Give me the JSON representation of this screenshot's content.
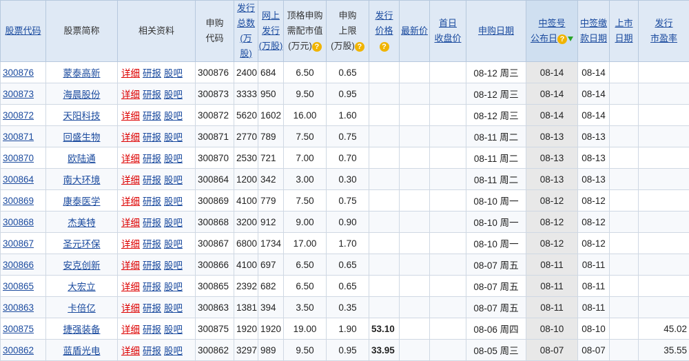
{
  "header": {
    "code": "股票代码",
    "name": "股票简称",
    "links": "相关资料",
    "subcode_l1": "申购",
    "subcode_l2": "代码",
    "total_l1": "发行",
    "total_l2": "总数",
    "total_l3": "(万股)",
    "online_l1": "网上",
    "online_l2": "发行",
    "online_l3": "(万股)",
    "cap_l1": "顶格申购",
    "cap_l2": "需配市值",
    "cap_l3": "(万元)",
    "limit_l1": "申购",
    "limit_l2": "上限",
    "limit_l3": "(万股)",
    "price_l1": "发行",
    "price_l2": "价格",
    "latest": "最新价",
    "firstday_l1": "首日",
    "firstday_l2": "收盘价",
    "subdate": "申购日期",
    "lot_l1": "中签号",
    "lot_l2": "公布日",
    "paydate_l1": "中签缴",
    "paydate_l2": "款日期",
    "listdate_l1": "上市",
    "listdate_l2": "日期",
    "pe_l1": "发行",
    "pe_l2": "市盈率",
    "help_icon": "?"
  },
  "link_labels": {
    "detail": "详细",
    "research": "研报",
    "forum": "股吧"
  },
  "rows": [
    {
      "code": "300876",
      "name": "蒙泰高新",
      "subcode": "300876",
      "total": "2400",
      "online": "684",
      "cap": "6.50",
      "limit": "0.65",
      "price": "",
      "latest": "",
      "first": "",
      "subdate": "08-12 周三",
      "lotdate": "08-14",
      "paydate": "08-14",
      "listdate": "",
      "pe": ""
    },
    {
      "code": "300873",
      "name": "海晨股份",
      "subcode": "300873",
      "total": "3333",
      "online": "950",
      "cap": "9.50",
      "limit": "0.95",
      "price": "",
      "latest": "",
      "first": "",
      "subdate": "08-12 周三",
      "lotdate": "08-14",
      "paydate": "08-14",
      "listdate": "",
      "pe": ""
    },
    {
      "code": "300872",
      "name": "天阳科技",
      "subcode": "300872",
      "total": "5620",
      "online": "1602",
      "cap": "16.00",
      "limit": "1.60",
      "price": "",
      "latest": "",
      "first": "",
      "subdate": "08-12 周三",
      "lotdate": "08-14",
      "paydate": "08-14",
      "listdate": "",
      "pe": ""
    },
    {
      "code": "300871",
      "name": "回盛生物",
      "subcode": "300871",
      "total": "2770",
      "online": "789",
      "cap": "7.50",
      "limit": "0.75",
      "price": "",
      "latest": "",
      "first": "",
      "subdate": "08-11 周二",
      "lotdate": "08-13",
      "paydate": "08-13",
      "listdate": "",
      "pe": ""
    },
    {
      "code": "300870",
      "name": "欧陆通",
      "subcode": "300870",
      "total": "2530",
      "online": "721",
      "cap": "7.00",
      "limit": "0.70",
      "price": "",
      "latest": "",
      "first": "",
      "subdate": "08-11 周二",
      "lotdate": "08-13",
      "paydate": "08-13",
      "listdate": "",
      "pe": ""
    },
    {
      "code": "300864",
      "name": "南大环境",
      "subcode": "300864",
      "total": "1200",
      "online": "342",
      "cap": "3.00",
      "limit": "0.30",
      "price": "",
      "latest": "",
      "first": "",
      "subdate": "08-11 周二",
      "lotdate": "08-13",
      "paydate": "08-13",
      "listdate": "",
      "pe": ""
    },
    {
      "code": "300869",
      "name": "康泰医学",
      "subcode": "300869",
      "total": "4100",
      "online": "779",
      "cap": "7.50",
      "limit": "0.75",
      "price": "",
      "latest": "",
      "first": "",
      "subdate": "08-10 周一",
      "lotdate": "08-12",
      "paydate": "08-12",
      "listdate": "",
      "pe": ""
    },
    {
      "code": "300868",
      "name": "杰美特",
      "subcode": "300868",
      "total": "3200",
      "online": "912",
      "cap": "9.00",
      "limit": "0.90",
      "price": "",
      "latest": "",
      "first": "",
      "subdate": "08-10 周一",
      "lotdate": "08-12",
      "paydate": "08-12",
      "listdate": "",
      "pe": ""
    },
    {
      "code": "300867",
      "name": "圣元环保",
      "subcode": "300867",
      "total": "6800",
      "online": "1734",
      "cap": "17.00",
      "limit": "1.70",
      "price": "",
      "latest": "",
      "first": "",
      "subdate": "08-10 周一",
      "lotdate": "08-12",
      "paydate": "08-12",
      "listdate": "",
      "pe": ""
    },
    {
      "code": "300866",
      "name": "安克创新",
      "subcode": "300866",
      "total": "4100",
      "online": "697",
      "cap": "6.50",
      "limit": "0.65",
      "price": "",
      "latest": "",
      "first": "",
      "subdate": "08-07 周五",
      "lotdate": "08-11",
      "paydate": "08-11",
      "listdate": "",
      "pe": ""
    },
    {
      "code": "300865",
      "name": "大宏立",
      "subcode": "300865",
      "total": "2392",
      "online": "682",
      "cap": "6.50",
      "limit": "0.65",
      "price": "",
      "latest": "",
      "first": "",
      "subdate": "08-07 周五",
      "lotdate": "08-11",
      "paydate": "08-11",
      "listdate": "",
      "pe": ""
    },
    {
      "code": "300863",
      "name": "卡倍亿",
      "subcode": "300863",
      "total": "1381",
      "online": "394",
      "cap": "3.50",
      "limit": "0.35",
      "price": "",
      "latest": "",
      "first": "",
      "subdate": "08-07 周五",
      "lotdate": "08-11",
      "paydate": "08-11",
      "listdate": "",
      "pe": ""
    },
    {
      "code": "300875",
      "name": "捷强装备",
      "subcode": "300875",
      "total": "1920",
      "online": "1920",
      "cap": "19.00",
      "limit": "1.90",
      "price": "53.10",
      "latest": "",
      "first": "",
      "subdate": "08-06 周四",
      "lotdate": "08-10",
      "paydate": "08-10",
      "listdate": "",
      "pe": "45.02"
    },
    {
      "code": "300862",
      "name": "蓝盾光电",
      "subcode": "300862",
      "total": "3297",
      "online": "989",
      "cap": "9.50",
      "limit": "0.95",
      "price": "33.95",
      "latest": "",
      "first": "",
      "subdate": "08-05 周三",
      "lotdate": "08-07",
      "paydate": "08-07",
      "listdate": "",
      "pe": "35.55"
    }
  ]
}
